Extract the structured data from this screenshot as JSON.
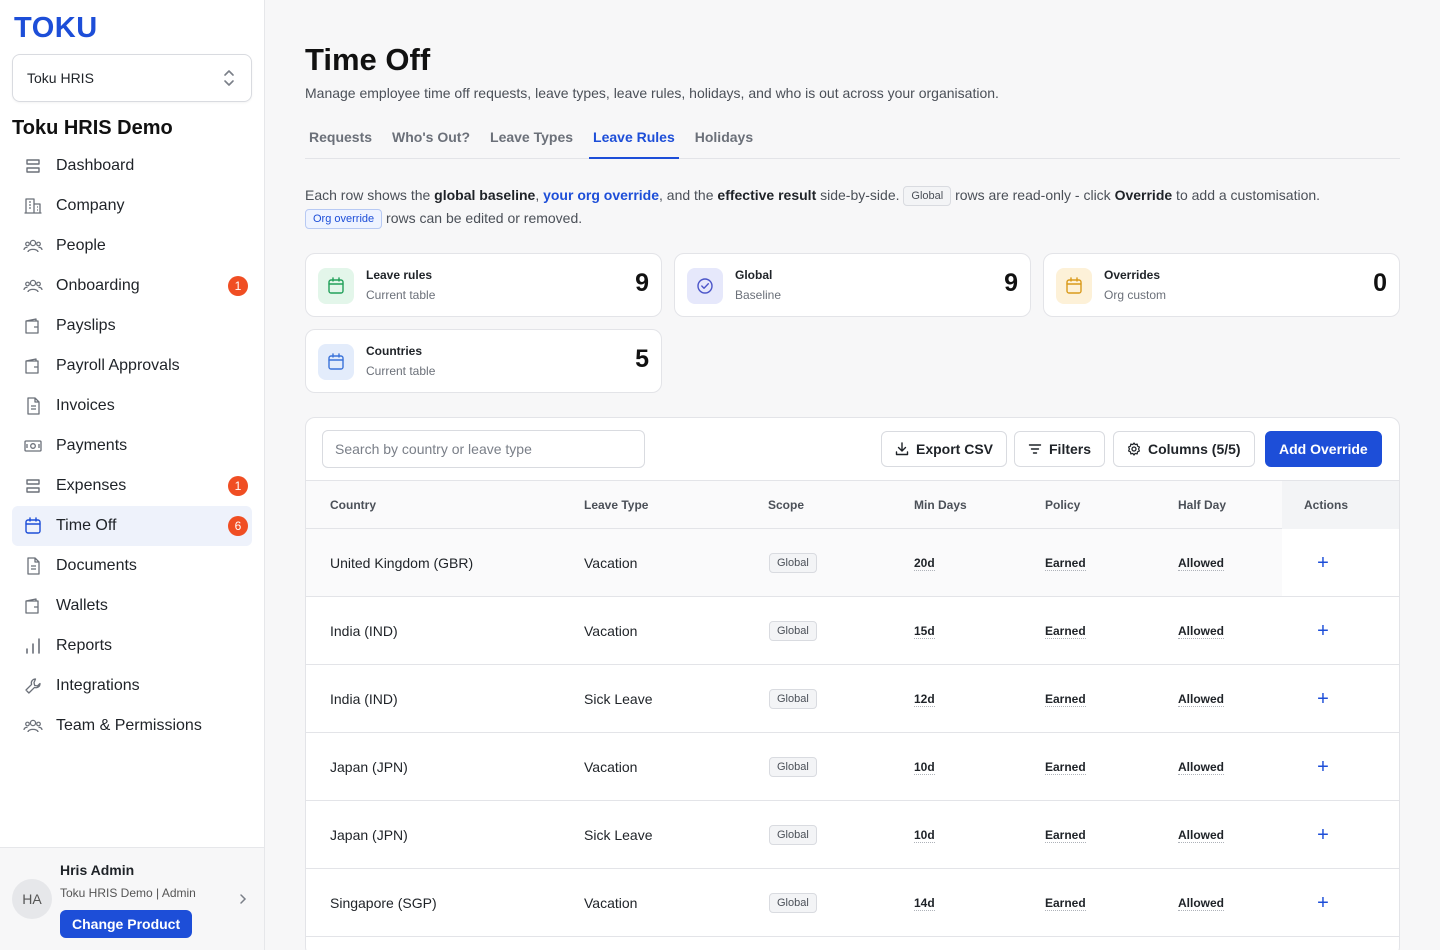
{
  "app": {
    "logo": "TOKU",
    "product": "Toku HRIS",
    "org_name": "Toku HRIS Demo"
  },
  "sidebar": {
    "items": [
      {
        "label": "Dashboard",
        "icon": "dashboard-icon"
      },
      {
        "label": "Company",
        "icon": "building-icon"
      },
      {
        "label": "People",
        "icon": "people-icon"
      },
      {
        "label": "Onboarding",
        "icon": "people-icon",
        "badge": "1"
      },
      {
        "label": "Payslips",
        "icon": "wallet-icon"
      },
      {
        "label": "Payroll Approvals",
        "icon": "wallet-icon"
      },
      {
        "label": "Invoices",
        "icon": "document-icon"
      },
      {
        "label": "Payments",
        "icon": "payments-icon"
      },
      {
        "label": "Expenses",
        "icon": "dashboard-icon",
        "badge": "1"
      },
      {
        "label": "Time Off",
        "icon": "calendar-icon",
        "badge": "6",
        "active": true
      },
      {
        "label": "Documents",
        "icon": "document-icon"
      },
      {
        "label": "Wallets",
        "icon": "wallet-icon"
      },
      {
        "label": "Reports",
        "icon": "bar-chart-icon"
      },
      {
        "label": "Integrations",
        "icon": "wrench-icon"
      },
      {
        "label": "Team & Permissions",
        "icon": "people-icon"
      }
    ]
  },
  "user": {
    "initials": "HA",
    "name": "Hris Admin",
    "org_role": "Toku HRIS Demo | Admin",
    "change_label": "Change Product"
  },
  "page": {
    "title": "Time Off",
    "subtitle": "Manage employee time off requests, leave types, leave rules, holidays, and who is out across your organisation.",
    "tabs": [
      {
        "label": "Requests"
      },
      {
        "label": "Who's Out?"
      },
      {
        "label": "Leave Types"
      },
      {
        "label": "Leave Rules",
        "active": true
      },
      {
        "label": "Holidays"
      }
    ]
  },
  "info": {
    "t1": "Each row shows the ",
    "b1": "global baseline",
    "t2": ", ",
    "link": "your org override",
    "t3": ", and the ",
    "b2": "effective result",
    "t4": " side-by-side. ",
    "chip_global": "Global",
    "t5": " rows are read-only - click ",
    "b3": "Override",
    "t6": " to add a customisation.",
    "chip_override": "Org override",
    "t7": " rows can be edited or removed."
  },
  "stats": [
    {
      "title": "Leave rules",
      "sub": "Current table",
      "value": "9",
      "color": "#e3f6ea",
      "icon_color": "#22a05a"
    },
    {
      "title": "Global",
      "sub": "Baseline",
      "value": "9",
      "color": "#e6e8fb",
      "icon_color": "#4b55c9"
    },
    {
      "title": "Overrides",
      "sub": "Org custom",
      "value": "0",
      "color": "#fdf1d8",
      "icon_color": "#d99a1b"
    },
    {
      "title": "Countries",
      "sub": "Current table",
      "value": "5",
      "color": "#e3ecfb",
      "icon_color": "#3b73d9"
    }
  ],
  "toolbar": {
    "search_placeholder": "Search by country or leave type",
    "export_label": "Export CSV",
    "filters_label": "Filters",
    "columns_label": "Columns (5/5)",
    "add_label": "Add Override"
  },
  "table": {
    "headers": [
      "Country",
      "Leave Type",
      "Scope",
      "Min Days",
      "Policy",
      "Half Day",
      "Actions"
    ],
    "rows": [
      {
        "country": "United Kingdom (GBR)",
        "leave_type": "Vacation",
        "scope": "Global",
        "min_days": "20d",
        "policy": "Earned",
        "half_day": "Allowed",
        "action": "+"
      },
      {
        "country": "India (IND)",
        "leave_type": "Vacation",
        "scope": "Global",
        "min_days": "15d",
        "policy": "Earned",
        "half_day": "Allowed",
        "action": "+"
      },
      {
        "country": "India (IND)",
        "leave_type": "Sick Leave",
        "scope": "Global",
        "min_days": "12d",
        "policy": "Earned",
        "half_day": "Allowed",
        "action": "+"
      },
      {
        "country": "Japan (JPN)",
        "leave_type": "Vacation",
        "scope": "Global",
        "min_days": "10d",
        "policy": "Earned",
        "half_day": "Allowed",
        "action": "+"
      },
      {
        "country": "Japan (JPN)",
        "leave_type": "Sick Leave",
        "scope": "Global",
        "min_days": "10d",
        "policy": "Earned",
        "half_day": "Allowed",
        "action": "+"
      },
      {
        "country": "Singapore (SGP)",
        "leave_type": "Vacation",
        "scope": "Global",
        "min_days": "14d",
        "policy": "Earned",
        "half_day": "Allowed",
        "action": "+"
      }
    ]
  }
}
